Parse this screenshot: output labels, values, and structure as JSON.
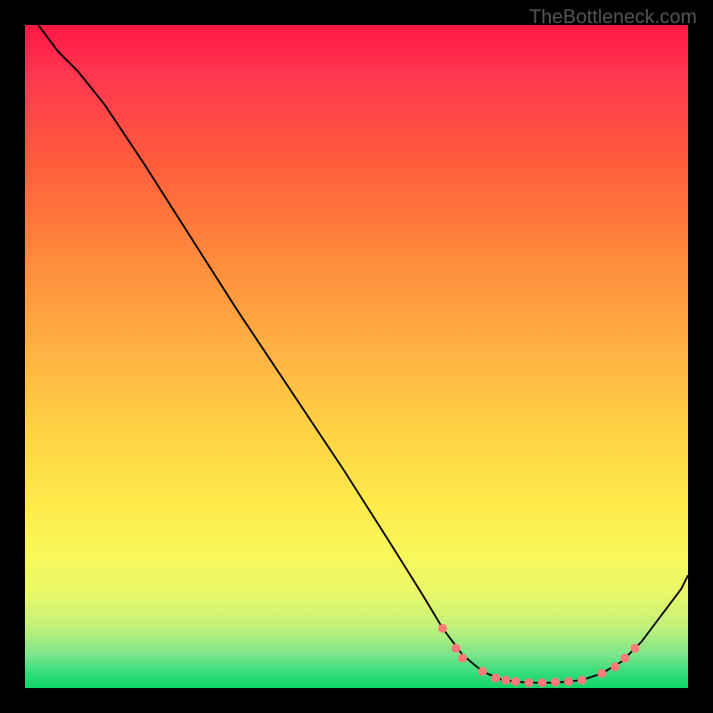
{
  "watermark": "TheBottleneck.com",
  "chart_data": {
    "type": "line",
    "title": "",
    "xlabel": "",
    "ylabel": "",
    "xlim": [
      0,
      100
    ],
    "ylim": [
      0,
      100
    ],
    "curve": [
      {
        "x": 2,
        "y": 100
      },
      {
        "x": 5,
        "y": 96
      },
      {
        "x": 8,
        "y": 93
      },
      {
        "x": 12,
        "y": 88
      },
      {
        "x": 18,
        "y": 79
      },
      {
        "x": 25,
        "y": 68
      },
      {
        "x": 32,
        "y": 57
      },
      {
        "x": 40,
        "y": 45
      },
      {
        "x": 48,
        "y": 33
      },
      {
        "x": 55,
        "y": 22
      },
      {
        "x": 60,
        "y": 14
      },
      {
        "x": 63,
        "y": 9
      },
      {
        "x": 66,
        "y": 5
      },
      {
        "x": 69,
        "y": 2.5
      },
      {
        "x": 72,
        "y": 1.2
      },
      {
        "x": 76,
        "y": 0.8
      },
      {
        "x": 80,
        "y": 0.8
      },
      {
        "x": 84,
        "y": 1.2
      },
      {
        "x": 87,
        "y": 2.2
      },
      {
        "x": 90,
        "y": 4
      },
      {
        "x": 93,
        "y": 7
      },
      {
        "x": 96,
        "y": 11
      },
      {
        "x": 99,
        "y": 15
      },
      {
        "x": 100,
        "y": 17
      }
    ],
    "points": [
      {
        "x": 63,
        "y": 9
      },
      {
        "x": 65,
        "y": 6
      },
      {
        "x": 66,
        "y": 4.5
      },
      {
        "x": 69,
        "y": 2.5
      },
      {
        "x": 71,
        "y": 1.5
      },
      {
        "x": 72.5,
        "y": 1.2
      },
      {
        "x": 74,
        "y": 1.0
      },
      {
        "x": 76,
        "y": 0.8
      },
      {
        "x": 78,
        "y": 0.8
      },
      {
        "x": 80,
        "y": 0.9
      },
      {
        "x": 82,
        "y": 1.0
      },
      {
        "x": 84,
        "y": 1.2
      },
      {
        "x": 87,
        "y": 2.2
      },
      {
        "x": 89,
        "y": 3.2
      },
      {
        "x": 90.5,
        "y": 4.5
      },
      {
        "x": 92,
        "y": 6
      }
    ],
    "background_gradient": {
      "top": "#ff1744",
      "mid": "#ffe94a",
      "bottom": "#10d56a"
    },
    "point_color": "#ff7a7a"
  }
}
